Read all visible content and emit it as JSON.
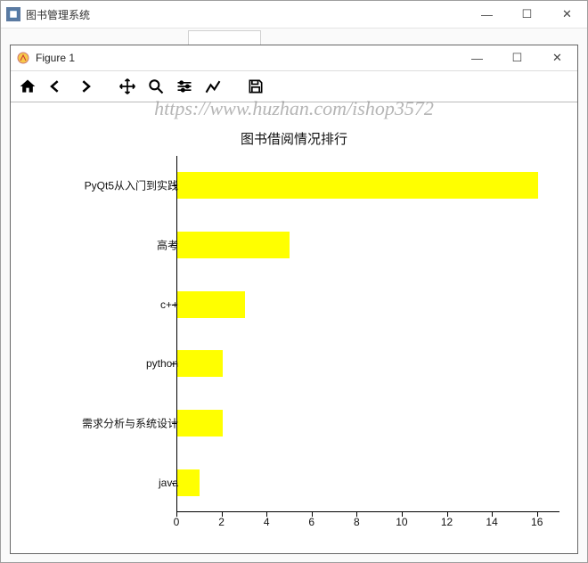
{
  "outer_window": {
    "title": "图书管理系统",
    "controls": {
      "min": "—",
      "max": "☐",
      "close": "✕"
    }
  },
  "inner_window": {
    "title": "Figure 1",
    "controls": {
      "min": "—",
      "max": "☐",
      "close": "✕"
    }
  },
  "toolbar": {
    "home": "home-icon",
    "back": "back-icon",
    "forward": "forward-icon",
    "pan": "pan-icon",
    "zoom": "zoom-icon",
    "subplots": "subplots-icon",
    "axes_edit": "axes-edit-icon",
    "save": "save-icon"
  },
  "watermark": "https://www.huzhan.com/ishop3572",
  "chart_data": {
    "type": "bar",
    "orientation": "horizontal",
    "title": "图书借阅情况排行",
    "xlabel": "",
    "ylabel": "",
    "xlim": [
      0,
      17
    ],
    "xticks": [
      0,
      2,
      4,
      6,
      8,
      10,
      12,
      14,
      16
    ],
    "categories": [
      "PyQt5从入门到实践",
      "高考",
      "c++",
      "python",
      "需求分析与系统设计",
      "java"
    ],
    "values": [
      16,
      5,
      3,
      2,
      2,
      1
    ],
    "bar_color": "#ffff00"
  }
}
